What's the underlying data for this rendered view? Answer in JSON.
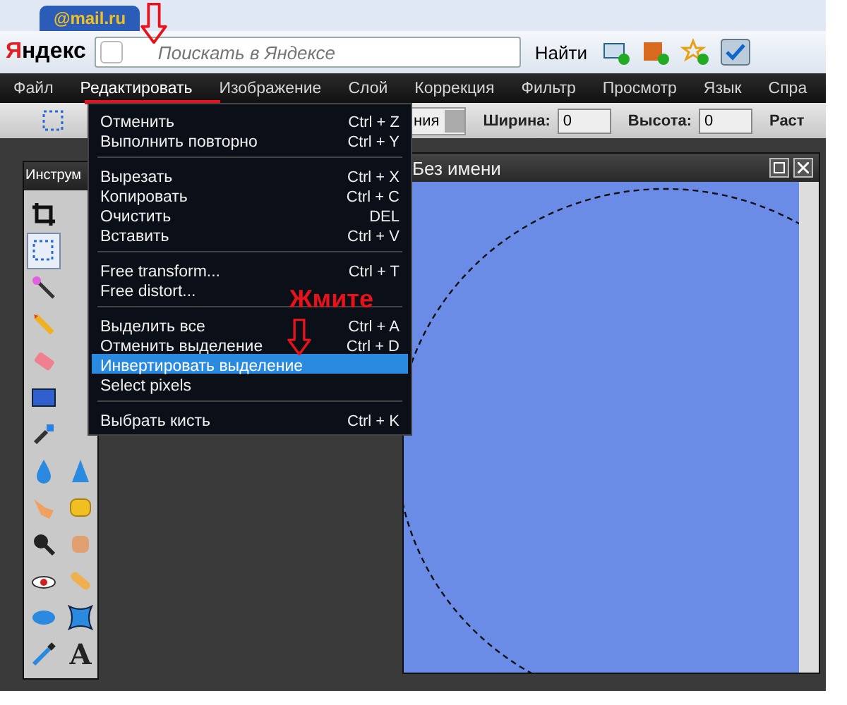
{
  "browser_tab": {
    "label": "@mail.ru"
  },
  "yandex_bar": {
    "logo": "Яндекс",
    "search_placeholder": "Поискать в Яндексе",
    "search_button": "Найти"
  },
  "menu_bar": [
    {
      "label": "Файл",
      "selected": false
    },
    {
      "label": "Редактировать",
      "selected": true
    },
    {
      "label": "Изображение",
      "selected": false
    },
    {
      "label": "Слой",
      "selected": false
    },
    {
      "label": "Коррекция",
      "selected": false
    },
    {
      "label": "Фильтр",
      "selected": false
    },
    {
      "label": "Просмотр",
      "selected": false
    },
    {
      "label": "Язык",
      "selected": false
    },
    {
      "label": "Спра",
      "selected": false
    }
  ],
  "options_bar": {
    "constraint_value": "ния",
    "width_label": "Ширина:",
    "width_value": "0",
    "height_label": "Высота:",
    "height_value": "0",
    "cut_label": "Раст"
  },
  "edit_menu": [
    {
      "kind": "item",
      "label": "Отменить",
      "shortcut": "Ctrl + Z",
      "selected": false
    },
    {
      "kind": "item",
      "label": "Выполнить повторно",
      "shortcut": "Ctrl + Y",
      "selected": false
    },
    {
      "kind": "separator"
    },
    {
      "kind": "item",
      "label": "Вырезать",
      "shortcut": "Ctrl + X",
      "selected": false
    },
    {
      "kind": "item",
      "label": "Копировать",
      "shortcut": "Ctrl + C",
      "selected": false
    },
    {
      "kind": "item",
      "label": "Очистить",
      "shortcut": "DEL",
      "selected": false
    },
    {
      "kind": "item",
      "label": "Вставить",
      "shortcut": "Ctrl + V",
      "selected": false
    },
    {
      "kind": "separator"
    },
    {
      "kind": "item",
      "label": "Free transform...",
      "shortcut": "Ctrl + T",
      "selected": false
    },
    {
      "kind": "item",
      "label": "Free distort...",
      "selected": false
    },
    {
      "kind": "separator"
    },
    {
      "kind": "item",
      "label": "Выделить все",
      "shortcut": "Ctrl + A",
      "selected": false
    },
    {
      "kind": "item",
      "label": "Отменить выделение",
      "shortcut": "Ctrl + D",
      "selected": false
    },
    {
      "kind": "item",
      "label": "Инвертировать выделение",
      "selected": true
    },
    {
      "kind": "item",
      "label": "Select pixels",
      "selected": false
    },
    {
      "kind": "separator"
    },
    {
      "kind": "item",
      "label": "Выбрать кисть",
      "shortcut": "Ctrl + K",
      "selected": false
    }
  ],
  "tools_panel": {
    "title": "Инструм",
    "tools": [
      {
        "kind": "crop",
        "selected": false
      },
      {
        "kind": "empty"
      },
      {
        "kind": "marquee",
        "selected": true
      },
      {
        "kind": "empty"
      },
      {
        "kind": "wand",
        "selected": false
      },
      {
        "kind": "empty"
      },
      {
        "kind": "pencil",
        "selected": false
      },
      {
        "kind": "empty"
      },
      {
        "kind": "eraser",
        "selected": false
      },
      {
        "kind": "empty"
      },
      {
        "kind": "gradient",
        "selected": false
      },
      {
        "kind": "empty"
      },
      {
        "kind": "replace",
        "selected": false
      },
      {
        "kind": "empty"
      },
      {
        "kind": "drop",
        "selected": false
      },
      {
        "kind": "cone",
        "selected": false
      },
      {
        "kind": "finger",
        "selected": false
      },
      {
        "kind": "sponge",
        "selected": false
      },
      {
        "kind": "zoom",
        "selected": false
      },
      {
        "kind": "fist",
        "selected": false
      },
      {
        "kind": "redeye",
        "selected": false
      },
      {
        "kind": "bandage",
        "selected": false
      },
      {
        "kind": "bloat",
        "selected": false
      },
      {
        "kind": "pinch",
        "selected": false
      },
      {
        "kind": "eyedropper",
        "selected": false
      },
      {
        "kind": "text",
        "label": "A",
        "selected": false
      }
    ]
  },
  "canvas_window": {
    "title": "Без имени"
  },
  "annotation": {
    "callout": "Жмите"
  }
}
